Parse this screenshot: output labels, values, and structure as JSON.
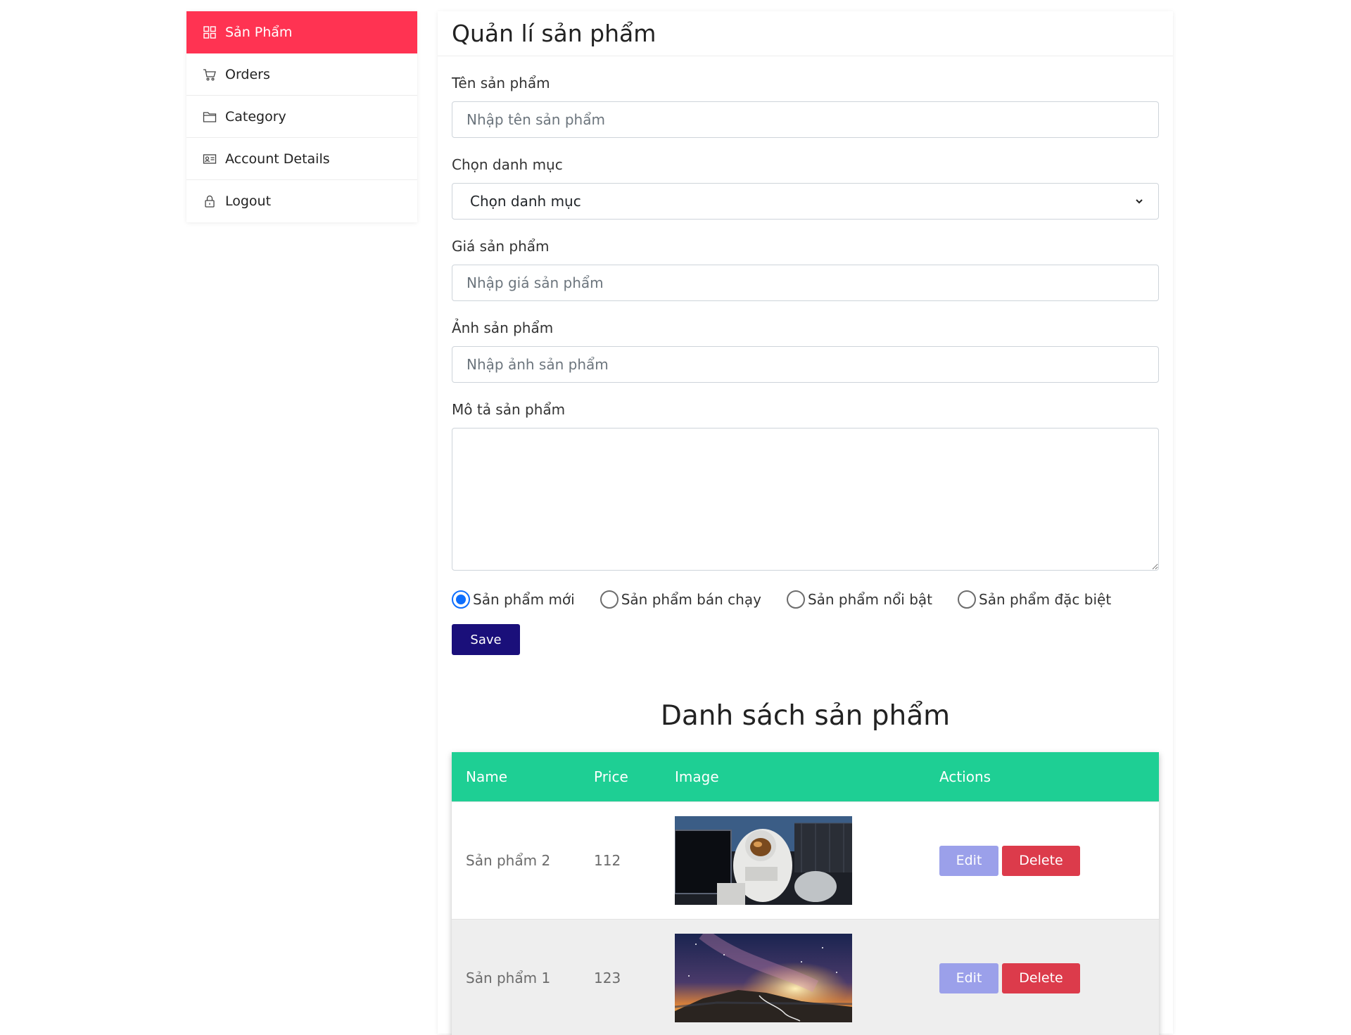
{
  "sidebar": {
    "items": [
      {
        "label": "Sản Phẩm",
        "icon": "grid-icon",
        "active": true
      },
      {
        "label": "Orders",
        "icon": "cart-icon"
      },
      {
        "label": "Category",
        "icon": "folder-icon"
      },
      {
        "label": "Account Details",
        "icon": "id-card-icon"
      },
      {
        "label": "Logout",
        "icon": "lock-icon"
      }
    ]
  },
  "main": {
    "title": "Quản lí sản phẩm",
    "form": {
      "name_label": "Tên sản phẩm",
      "name_placeholder": "Nhập tên sản phẩm",
      "name_value": "",
      "category_label": "Chọn danh mục",
      "category_selected": "Chọn danh mục",
      "price_label": "Giá sản phẩm",
      "price_placeholder": "Nhập giá sản phẩm",
      "price_value": "",
      "image_label": "Ảnh sản phẩm",
      "image_placeholder": "Nhập ảnh sản phẩm",
      "image_value": "",
      "desc_label": "Mô tả sản phẩm",
      "desc_value": "",
      "radios": [
        {
          "label": "Sản phẩm mới",
          "checked": true
        },
        {
          "label": "Sản phẩm bán chạy",
          "checked": false
        },
        {
          "label": "Sản phẩm nổi bật",
          "checked": false
        },
        {
          "label": "Sản phẩm đặc biệt",
          "checked": false
        }
      ],
      "save_label": "Save"
    },
    "list_title": "Danh sách sản phẩm",
    "table": {
      "headers": [
        "Name",
        "Price",
        "Image",
        "Actions"
      ],
      "rows": [
        {
          "name": "Sản phẩm 2",
          "price": "112",
          "image": "astronaut-photo",
          "edit_label": "Edit",
          "delete_label": "Delete"
        },
        {
          "name": "Sản phẩm 1",
          "price": "123",
          "image": "milky-way-mountain-photo",
          "edit_label": "Edit",
          "delete_label": "Delete"
        }
      ]
    }
  },
  "colors": {
    "sidebar_active_bg": "#ff3352",
    "save_button_bg": "#1a0f7a",
    "table_header_bg": "#1ecf94",
    "edit_button_bg": "#9ba0ea",
    "delete_button_bg": "#dc3b4b",
    "radio_checked": "#0d6efd"
  }
}
